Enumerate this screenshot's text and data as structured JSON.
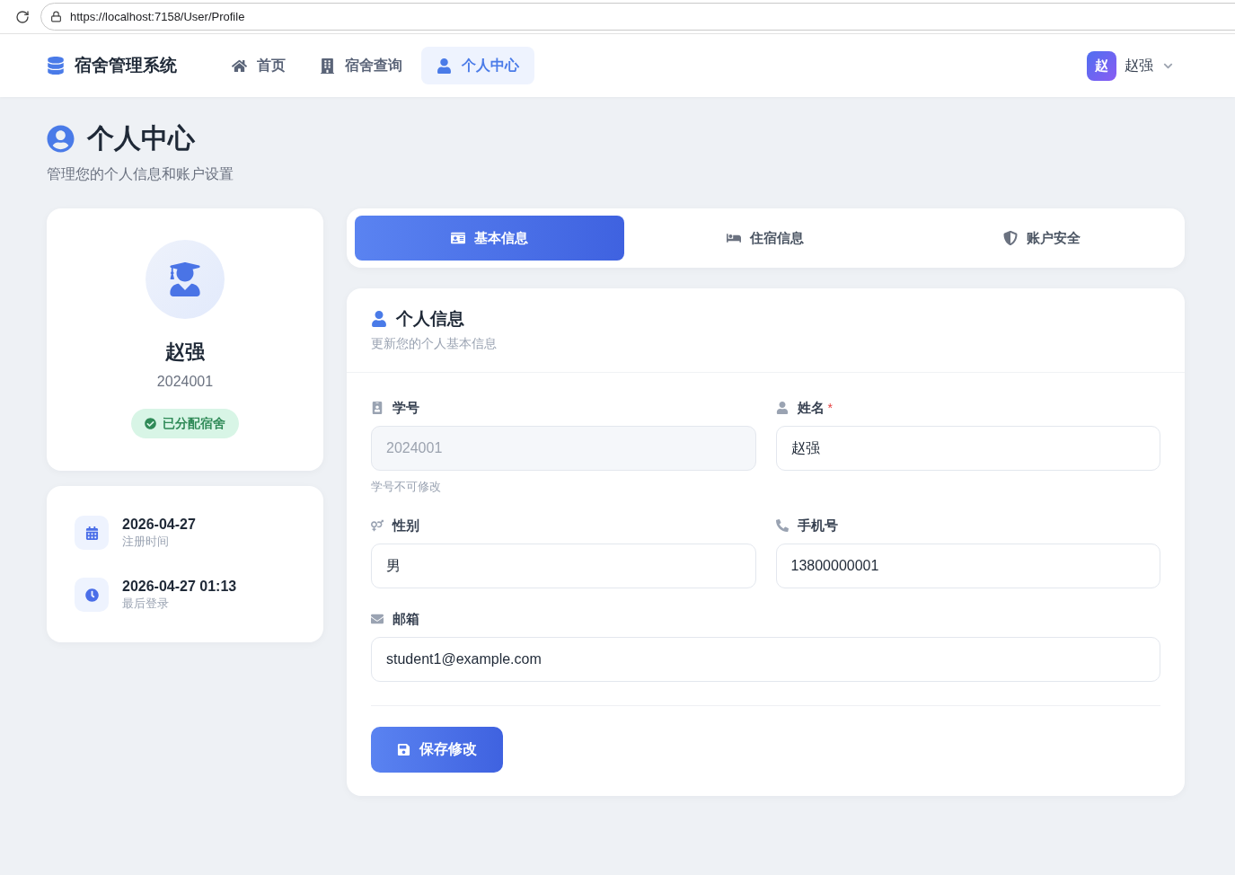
{
  "browser": {
    "url": "https://localhost:7158/User/Profile"
  },
  "navbar": {
    "brand": "宿舍管理系统",
    "items": [
      {
        "kind": "home",
        "label": "首页",
        "selected": false
      },
      {
        "kind": "building",
        "label": "宿舍查询",
        "selected": false
      },
      {
        "kind": "user",
        "label": "个人中心",
        "selected": true
      }
    ],
    "user": {
      "avatar_text": "赵",
      "name": "赵强"
    }
  },
  "page_header": {
    "title": "个人中心",
    "subtitle": "管理您的个人信息和账户设置"
  },
  "profile_card": {
    "name": "赵强",
    "student_id": "2024001",
    "status": {
      "kind": "success",
      "label": "已分配宿舍"
    }
  },
  "info_card": {
    "items": [
      {
        "kind": "calendar",
        "value": "2026-04-27",
        "label": "注册时间"
      },
      {
        "kind": "clock",
        "value": "2026-04-27 01:13",
        "label": "最后登录"
      }
    ]
  },
  "tabs": [
    {
      "kind": "id-card",
      "label": "基本信息",
      "selected": true
    },
    {
      "kind": "bed",
      "label": "住宿信息",
      "selected": false
    },
    {
      "kind": "shield",
      "label": "账户安全",
      "selected": false
    }
  ],
  "form": {
    "title": "个人信息",
    "subtitle": "更新您的个人基本信息",
    "fields": [
      {
        "kind": "student-id",
        "label": "学号",
        "value": "2024001",
        "disabled": true,
        "hint": "学号不可修改"
      },
      {
        "kind": "name",
        "label": "姓名",
        "required_mark": "*",
        "value": "赵强",
        "disabled": false
      },
      {
        "kind": "gender",
        "label": "性别",
        "value": "男",
        "disabled": false
      },
      {
        "kind": "phone",
        "label": "手机号",
        "value": "13800000001",
        "disabled": false
      },
      {
        "kind": "email",
        "label": "邮箱",
        "value": "student1@example.com",
        "disabled": false
      }
    ],
    "submit_button": "保存修改"
  }
}
